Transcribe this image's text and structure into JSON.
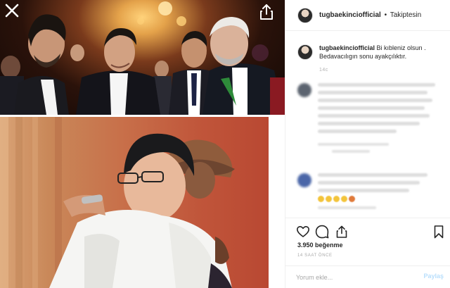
{
  "post": {
    "username": "tugbaekinciofficial",
    "follow_state": "Takiptesin",
    "separator": "•"
  },
  "caption": {
    "username": "tugbaekinciofficial",
    "text": "Bi kıbleniz olsun . Bedavacılıgın sonu ayakçılıktır.",
    "time": "14c"
  },
  "stats": {
    "likes": "3.950 beğenme",
    "time": "14 SAAT ÖNCE"
  },
  "comment_box": {
    "placeholder": "Yorum ekle...",
    "post_label": "Paylaş"
  },
  "icons": {
    "close": "close-icon",
    "share_top": "share-icon",
    "like": "heart-icon",
    "comment": "comment-icon",
    "share": "share-icon",
    "save": "bookmark-icon"
  },
  "colors": {
    "text": "#262626",
    "muted": "#a8a8a8",
    "border": "#efefef",
    "post_disabled": "#b9dffc"
  }
}
